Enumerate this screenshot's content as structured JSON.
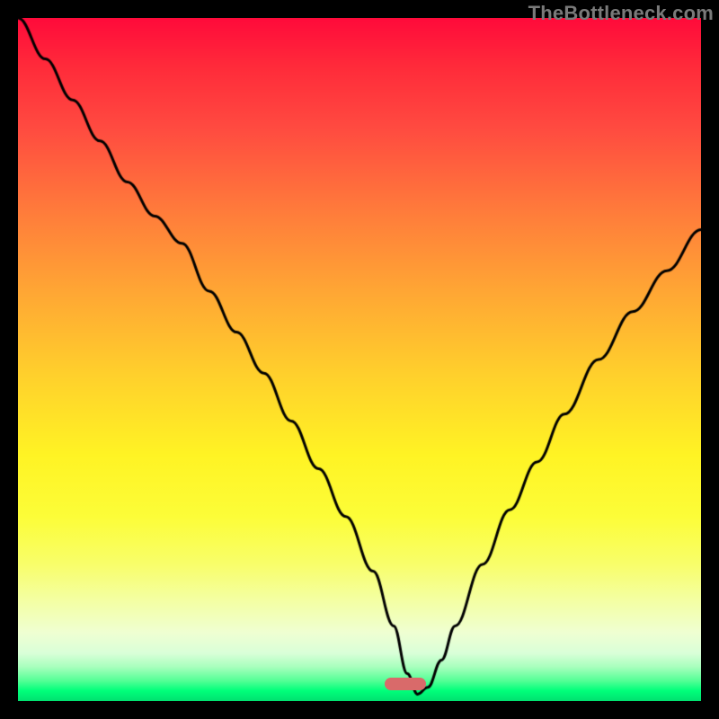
{
  "watermark": "TheBottleneck.com",
  "marker": {
    "x_fraction": 0.567,
    "y_fraction": 0.975,
    "color": "#d96a6a"
  },
  "chart_data": {
    "type": "line",
    "title": "",
    "xlabel": "",
    "ylabel": "",
    "xlim": [
      0,
      100
    ],
    "ylim": [
      0,
      100
    ],
    "grid": false,
    "legend": false,
    "series": [
      {
        "name": "bottleneck-curve",
        "x": [
          0,
          4,
          8,
          12,
          16,
          20,
          24,
          28,
          32,
          36,
          40,
          44,
          48,
          52,
          55,
          57,
          58.5,
          60,
          62,
          64,
          68,
          72,
          76,
          80,
          85,
          90,
          95,
          100
        ],
        "y": [
          100,
          94,
          88,
          82,
          76,
          71,
          67,
          60,
          54,
          48,
          41,
          34,
          27,
          19,
          11,
          4,
          1,
          2,
          6,
          11,
          20,
          28,
          35,
          42,
          50,
          57,
          63,
          69
        ]
      }
    ],
    "gradient_stops": [
      {
        "pct": 0,
        "color": "#ff0a3a"
      },
      {
        "pct": 7,
        "color": "#ff2a3a"
      },
      {
        "pct": 16,
        "color": "#ff4a40"
      },
      {
        "pct": 28,
        "color": "#ff7a3b"
      },
      {
        "pct": 40,
        "color": "#ffa634"
      },
      {
        "pct": 52,
        "color": "#ffcf2c"
      },
      {
        "pct": 64,
        "color": "#fff324"
      },
      {
        "pct": 73,
        "color": "#fcfd38"
      },
      {
        "pct": 80,
        "color": "#f8fe6a"
      },
      {
        "pct": 85,
        "color": "#f4ffa0"
      },
      {
        "pct": 90,
        "color": "#efffd2"
      },
      {
        "pct": 93,
        "color": "#d9ffd8"
      },
      {
        "pct": 95,
        "color": "#a8ffbd"
      },
      {
        "pct": 97,
        "color": "#55ff96"
      },
      {
        "pct": 98.5,
        "color": "#00ff7a"
      },
      {
        "pct": 100,
        "color": "#00e070"
      }
    ]
  }
}
